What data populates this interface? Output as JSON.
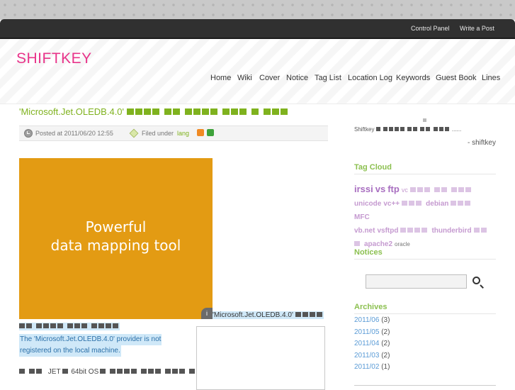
{
  "admin_bar": {
    "control_panel": "Control Panel",
    "write_post": "Write a Post"
  },
  "site": {
    "title": "SHIFTKEY"
  },
  "nav": {
    "items": [
      "Home",
      "Wiki",
      "Cover",
      "Notice",
      "Tag List",
      "Location Log",
      "Keywords",
      "Guest Book",
      "Lines"
    ]
  },
  "post": {
    "title": "'Microsoft.Jet.OLEDB.4.0'",
    "meta": {
      "posted": "Posted at 2011/06/20 12:55",
      "filed_under": "Filed under",
      "category": "lang"
    },
    "ad": {
      "line1": "Powerful",
      "line2": "data mapping tool"
    },
    "caption_right": "'Microsoft.Jet.OLEDB.4.0'",
    "error_line1": "The 'Microsoft.Jet.OLEDB.4.0' provider is not",
    "error_line2": "registered on the local machine.",
    "jet_text": "JET",
    "os_text": "64bit OS"
  },
  "sidebar": {
    "about_name": "Shiftkey",
    "about_signature": "- shiftkey",
    "tag_cloud_title": "Tag Cloud",
    "tags": {
      "irssi": "irssi",
      "vs": "vs",
      "ftp": "ftp",
      "vc": "vc",
      "unicode": "unicode",
      "vcpp": "vc++",
      "debian": "debian",
      "mfc": "MFC",
      "vbnet": "vb.net",
      "vsftpd": "vsftpd",
      "thunderbird": "thunderbird",
      "apache2": "apache2",
      "oracle": "oracle"
    },
    "notices_title": "Notices",
    "archives_title": "Archives",
    "archives": [
      {
        "month": "2011/06",
        "count": "(3)"
      },
      {
        "month": "2011/05",
        "count": "(2)"
      },
      {
        "month": "2011/04",
        "count": "(2)"
      },
      {
        "month": "2011/03",
        "count": "(2)"
      },
      {
        "month": "2011/02",
        "count": "(1)"
      }
    ]
  },
  "colors": {
    "logo": "#e8348a",
    "title_green": "#7fb21e",
    "ad_orange": "#e39b13",
    "tag_purple": "#c59ad0",
    "link_blue": "#5a9bd6"
  }
}
